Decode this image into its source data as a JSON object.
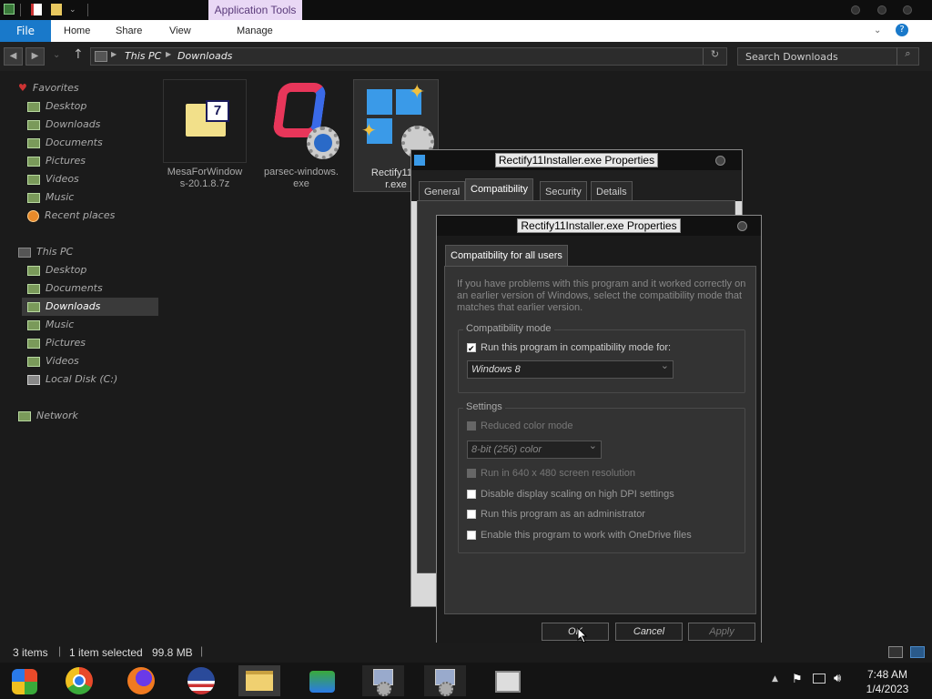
{
  "window": {
    "contextual_tab": "Application Tools",
    "ribbon_tabs": [
      "File",
      "Home",
      "Share",
      "View",
      "Manage"
    ]
  },
  "address": {
    "crumbs": [
      "This PC",
      "Downloads"
    ],
    "search_placeholder": "Search Downloads"
  },
  "sidebar": {
    "favorites_header": "Favorites",
    "favorites": [
      "Desktop",
      "Downloads",
      "Documents",
      "Pictures",
      "Videos",
      "Music",
      "Recent places"
    ],
    "thispc_header": "This PC",
    "thispc": [
      "Desktop",
      "Documents",
      "Downloads",
      "Music",
      "Pictures",
      "Videos",
      "Local Disk (C:)"
    ],
    "network": "Network",
    "selected": "Downloads"
  },
  "files": [
    {
      "name": "MesaForWindows-20.1.8.7z",
      "line1": "MesaForWindow",
      "line2": "s-20.1.8.7z"
    },
    {
      "name": "parsec-windows.exe",
      "line1": "parsec-windows.",
      "line2": "exe"
    },
    {
      "name": "Rectify11Installer.exe",
      "line1": "Rectify11In",
      "line2": "r.exe"
    }
  ],
  "status": {
    "items": "3 items",
    "selected": "1 item selected",
    "size": "99.8 MB"
  },
  "props_back": {
    "title": "Rectify11Installer.exe Properties",
    "tabs": [
      "General",
      "Compatibility",
      "Security",
      "Details"
    ],
    "active_tab": "Compatibility"
  },
  "props_front": {
    "title": "Rectify11Installer.exe Properties",
    "tab": "Compatibility for all users",
    "intro": "If you have problems with this program and it worked correctly on an earlier version of Windows, select the compatibility mode that matches that earlier version.",
    "compat_group": "Compatibility mode",
    "compat_check": "Run this program in compatibility mode for:",
    "compat_value": "Windows 8",
    "settings_group": "Settings",
    "reduced_color": "Reduced color mode",
    "color_value": "8-bit (256) color",
    "res_640": "Run in 640 x 480 screen resolution",
    "dpi": "Disable display scaling on high DPI settings",
    "admin": "Run this program as an administrator",
    "onedrive": "Enable this program to work with OneDrive files",
    "ok": "OK",
    "cancel": "Cancel",
    "apply": "Apply"
  },
  "taskbar": {
    "time": "7:48 AM",
    "date": "1/4/2023",
    "apps": [
      "start-icon",
      "chrome-icon",
      "firefox-icon",
      "obama-logo-icon",
      "file-explorer-icon",
      "network-people-icon",
      "installer-icon-1",
      "installer-icon-2",
      "archive-icon"
    ]
  },
  "colors": {
    "file_tab": "#1979ca",
    "contextual_tab": "#e9d8f5"
  }
}
